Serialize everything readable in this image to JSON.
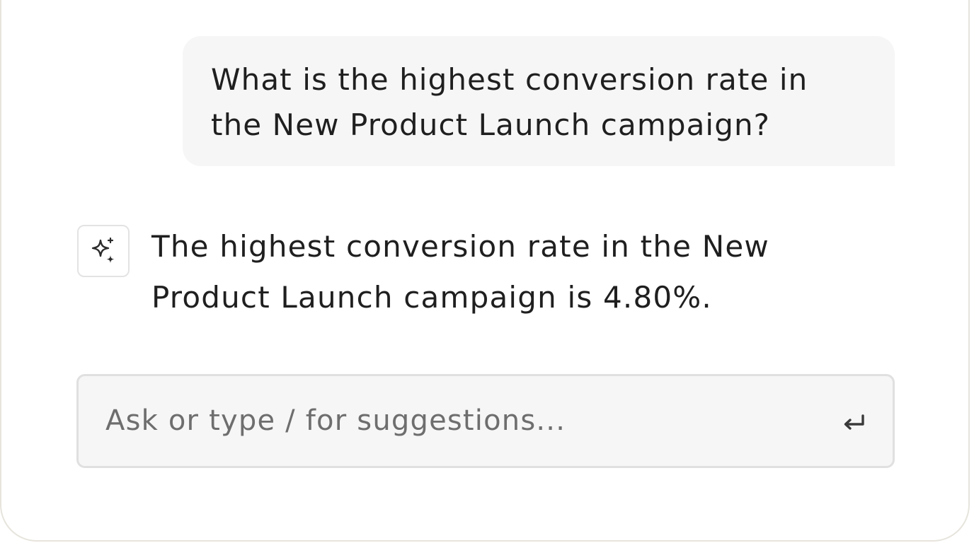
{
  "conversation": {
    "user_message": "What is the highest conversion rate in the New Product Launch campaign?",
    "assistant_message": "The highest conversion rate in the New Product Launch campaign is 4.80%."
  },
  "assistant": {
    "icon": "sparkles-icon"
  },
  "composer": {
    "placeholder": "Ask or type / for suggestions...",
    "value": "",
    "submit_icon": "enter-icon"
  },
  "colors": {
    "bubble_bg": "#f6f6f6",
    "text": "#1f1f1f",
    "placeholder": "#6e6e6e",
    "border": "#e0e0e0"
  }
}
